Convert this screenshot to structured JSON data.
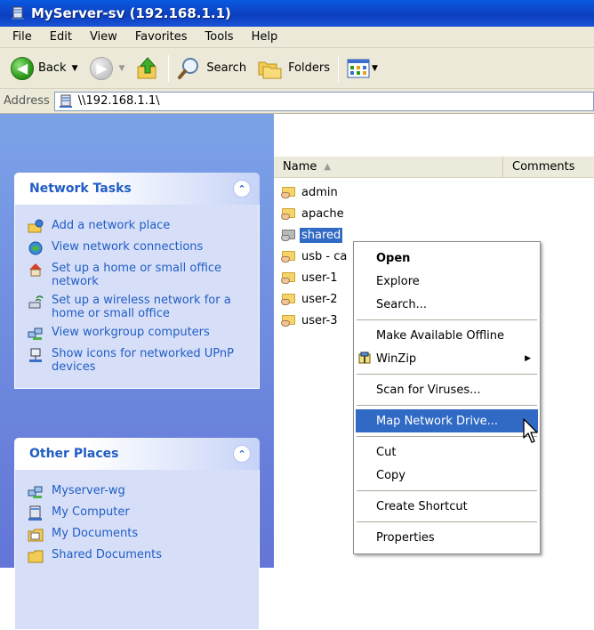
{
  "window": {
    "title": "MyServer-sv (192.168.1.1)"
  },
  "menubar": {
    "items": [
      "File",
      "Edit",
      "View",
      "Favorites",
      "Tools",
      "Help"
    ]
  },
  "toolbar": {
    "back_label": "Back",
    "search_label": "Search",
    "folders_label": "Folders"
  },
  "address": {
    "label": "Address",
    "value": "\\\\192.168.1.1\\"
  },
  "left_panel": {
    "network_tasks": {
      "title": "Network Tasks",
      "items": [
        {
          "label": "Add a network place",
          "icon": "add-network-place-icon"
        },
        {
          "label": "View network connections",
          "icon": "network-connections-icon"
        },
        {
          "label": "Set up a home or small office network",
          "icon": "home-network-icon"
        },
        {
          "label": "Set up a wireless network for a home or small office",
          "icon": "wireless-icon"
        },
        {
          "label": "View workgroup computers",
          "icon": "workgroup-icon"
        },
        {
          "label": "Show icons for networked UPnP devices",
          "icon": "upnp-icon"
        }
      ]
    },
    "other_places": {
      "title": "Other Places",
      "items": [
        {
          "label": "Myserver-wg",
          "icon": "workgroup-icon"
        },
        {
          "label": "My Computer",
          "icon": "computer-icon"
        },
        {
          "label": "My Documents",
          "icon": "documents-icon"
        },
        {
          "label": "Shared Documents",
          "icon": "shared-documents-icon"
        }
      ]
    }
  },
  "file_list": {
    "columns": [
      "Name",
      "Comments"
    ],
    "items": [
      {
        "name": "admin",
        "selected": false
      },
      {
        "name": "apache",
        "selected": false
      },
      {
        "name": "shared",
        "selected": true
      },
      {
        "name": "usb - ca",
        "selected": false
      },
      {
        "name": "user-1",
        "selected": false
      },
      {
        "name": "user-2",
        "selected": false
      },
      {
        "name": "user-3",
        "selected": false
      }
    ]
  },
  "context_menu": {
    "items": [
      {
        "label": "Open",
        "bold": true
      },
      {
        "label": "Explore"
      },
      {
        "label": "Search..."
      },
      {
        "label": "Make Available Offline"
      },
      {
        "label": "WinZip",
        "has_submenu": true
      },
      {
        "label": "Scan for Viruses..."
      },
      {
        "label": "Map Network Drive...",
        "highlighted": true
      },
      {
        "label": "Cut"
      },
      {
        "label": "Copy"
      },
      {
        "label": "Create Shortcut"
      },
      {
        "label": "Properties"
      }
    ]
  },
  "colors": {
    "title_bar": "#0c44c6",
    "task_link": "#215dc6",
    "selection": "#316ac5"
  }
}
